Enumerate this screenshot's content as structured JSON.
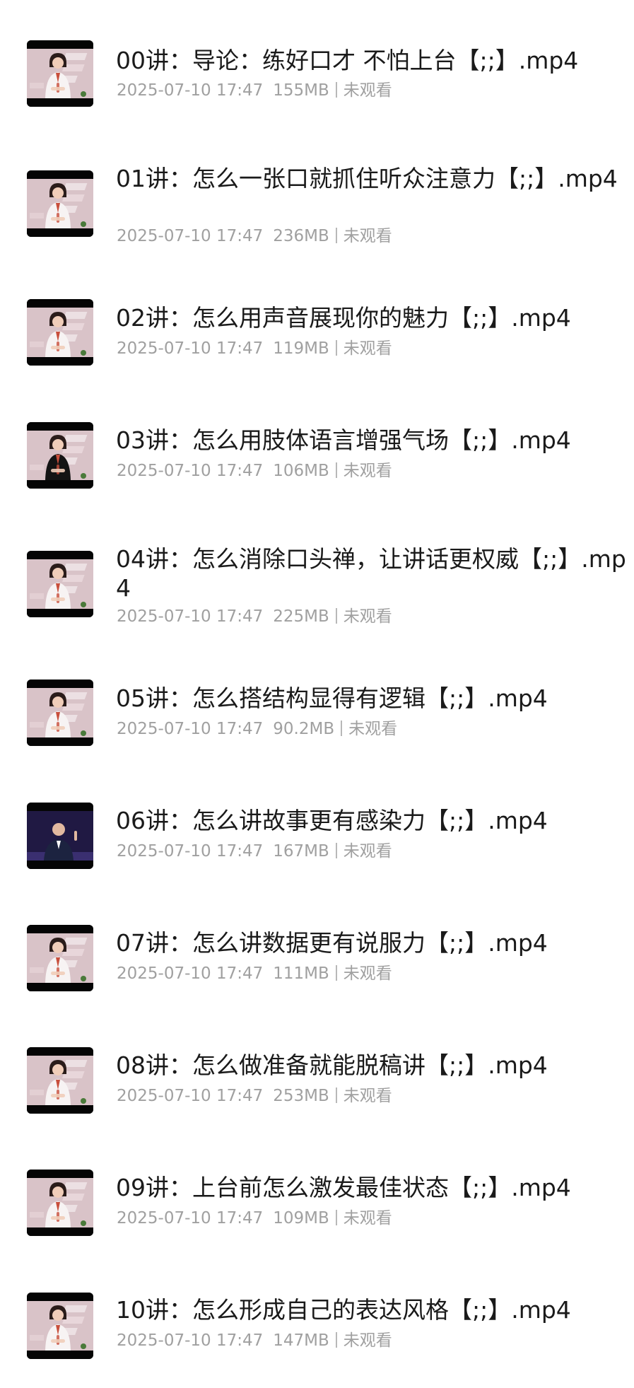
{
  "files": [
    {
      "title": "00讲：导论：练好口才 不怕上台【;;】.mp4",
      "date": "2025-07-10 17:47",
      "size": "155MB",
      "status": "未观看",
      "thumb": "light",
      "icon": "video-thumbnail"
    },
    {
      "title": "01讲：怎么一张口就抓住听众注意力【;;】.mp4",
      "date": "2025-07-10 17:47",
      "size": "236MB",
      "status": "未观看",
      "thumb": "light",
      "icon": "video-thumbnail"
    },
    {
      "title": "02讲：怎么用声音展现你的魅力【;;】.mp4",
      "date": "2025-07-10 17:47",
      "size": "119MB",
      "status": "未观看",
      "thumb": "light",
      "icon": "video-thumbnail"
    },
    {
      "title": "03讲：怎么用肢体语言增强气场【;;】.mp4",
      "date": "2025-07-10 17:47",
      "size": "106MB",
      "status": "未观看",
      "thumb": "black-outfit",
      "icon": "video-thumbnail"
    },
    {
      "title": "04讲：怎么消除口头禅，让讲话更权威【;;】.mp4",
      "date": "2025-07-10 17:47",
      "size": "225MB",
      "status": "未观看",
      "thumb": "light",
      "icon": "video-thumbnail"
    },
    {
      "title": "05讲：怎么搭结构显得有逻辑【;;】.mp4",
      "date": "2025-07-10 17:47",
      "size": "90.2MB",
      "status": "未观看",
      "thumb": "light",
      "icon": "video-thumbnail"
    },
    {
      "title": "06讲：怎么讲故事更有感染力【;;】.mp4",
      "date": "2025-07-10 17:47",
      "size": "167MB",
      "status": "未观看",
      "thumb": "dark-stage",
      "icon": "video-thumbnail"
    },
    {
      "title": "07讲：怎么讲数据更有说服力【;;】.mp4",
      "date": "2025-07-10 17:47",
      "size": "111MB",
      "status": "未观看",
      "thumb": "light",
      "icon": "video-thumbnail"
    },
    {
      "title": "08讲：怎么做准备就能脱稿讲【;;】.mp4",
      "date": "2025-07-10 17:47",
      "size": "253MB",
      "status": "未观看",
      "thumb": "light",
      "icon": "video-thumbnail"
    },
    {
      "title": "09讲：上台前怎么激发最佳状态【;;】.mp4",
      "date": "2025-07-10 17:47",
      "size": "109MB",
      "status": "未观看",
      "thumb": "light",
      "icon": "video-thumbnail"
    },
    {
      "title": "10讲：怎么形成自己的表达风格【;;】.mp4",
      "date": "2025-07-10 17:47",
      "size": "147MB",
      "status": "未观看",
      "thumb": "light",
      "icon": "video-thumbnail"
    }
  ],
  "colors": {
    "title": "#1a1a1a",
    "meta": "#a0a0a0",
    "background": "#ffffff"
  }
}
